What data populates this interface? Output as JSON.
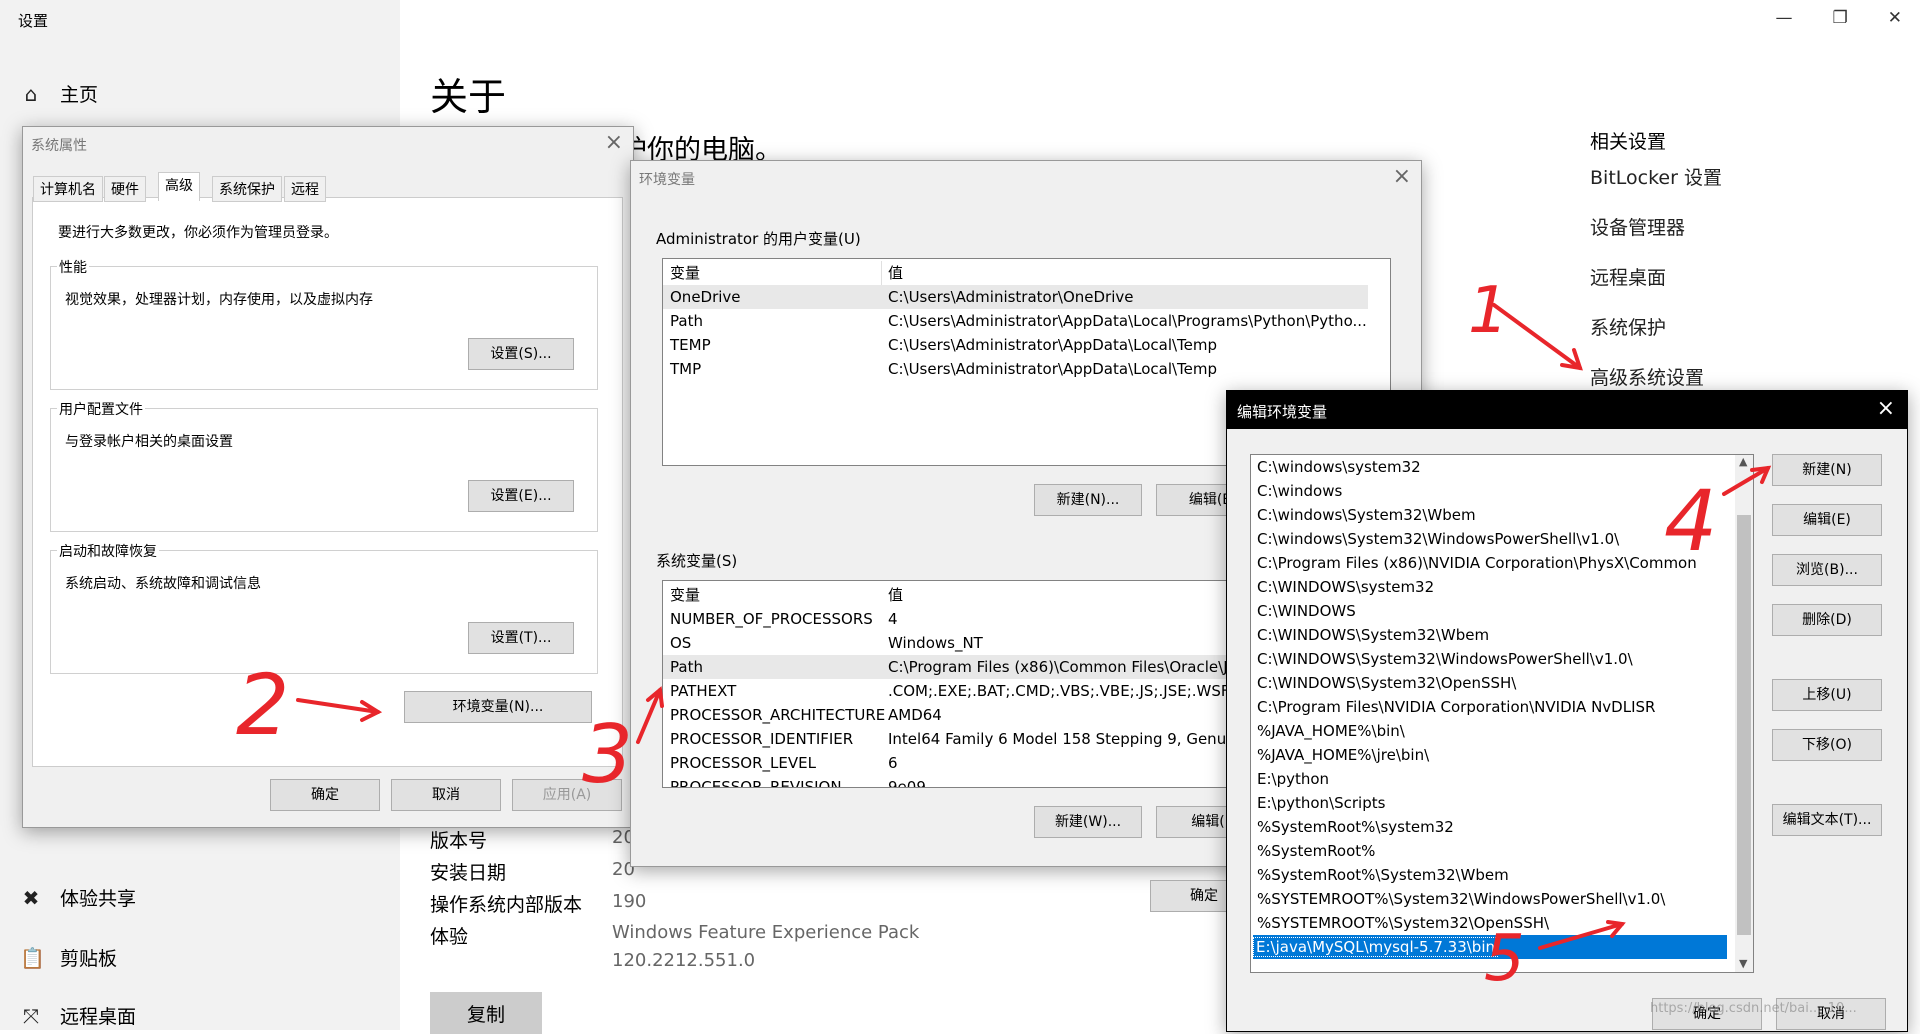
{
  "settings": {
    "title": "设置",
    "nav": {
      "home": "主页",
      "experience": "体验共享",
      "clipboard": "剪贴板",
      "remote": "远程桌面"
    },
    "page_title": "关于",
    "protect_text": "护你的电脑。",
    "related": {
      "title": "相关设置",
      "links": [
        "BitLocker 设置",
        "设备管理器",
        "远程桌面",
        "系统保护",
        "高级系统设置"
      ]
    },
    "specs": [
      {
        "label": "版本号",
        "value": "20"
      },
      {
        "label": "安装日期",
        "value": "20"
      },
      {
        "label": "操作系统内部版本",
        "value": "190"
      },
      {
        "label": "体验",
        "value": "Windows Feature Experience Pack"
      }
    ],
    "experience_version": "120.2212.551.0",
    "copy_label": "复制"
  },
  "sysprops": {
    "title": "系统属性",
    "tabs": [
      "计算机名",
      "硬件",
      "高级",
      "系统保护",
      "远程"
    ],
    "active_tab": "高级",
    "admin_note": "要进行大多数更改，你必须作为管理员登录。",
    "performance": {
      "label": "性能",
      "desc": "视觉效果，处理器计划，内存使用，以及虚拟内存",
      "button": "设置(S)..."
    },
    "profile": {
      "label": "用户配置文件",
      "desc": "与登录帐户相关的桌面设置",
      "button": "设置(E)..."
    },
    "startup": {
      "label": "启动和故障恢复",
      "desc": "系统启动、系统故障和调试信息",
      "button": "设置(T)..."
    },
    "env_button": "环境变量(N)...",
    "ok": "确定",
    "cancel": "取消",
    "apply": "应用(A)"
  },
  "envvars": {
    "title": "环境变量",
    "user_label": "Administrator 的用户变量(U)",
    "col_var": "变量",
    "col_val": "值",
    "user_vars": [
      {
        "k": "OneDrive",
        "v": "C:\\Users\\Administrator\\OneDrive"
      },
      {
        "k": "Path",
        "v": "C:\\Users\\Administrator\\AppData\\Local\\Programs\\Python\\Pytho..."
      },
      {
        "k": "TEMP",
        "v": "C:\\Users\\Administrator\\AppData\\Local\\Temp"
      },
      {
        "k": "TMP",
        "v": "C:\\Users\\Administrator\\AppData\\Local\\Temp"
      }
    ],
    "user_new": "新建(N)...",
    "user_edit": "编辑(E",
    "sys_label": "系统变量(S)",
    "sys_vars": [
      {
        "k": "NUMBER_OF_PROCESSORS",
        "v": "4"
      },
      {
        "k": "OS",
        "v": "Windows_NT"
      },
      {
        "k": "Path",
        "v": "C:\\Program Files (x86)\\Common Files\\Oracle\\Ja"
      },
      {
        "k": "PATHEXT",
        "v": ".COM;.EXE;.BAT;.CMD;.VBS;.VBE;.JS;.JSE;.WSF;.W"
      },
      {
        "k": "PROCESSOR_ARCHITECTURE",
        "v": "AMD64"
      },
      {
        "k": "PROCESSOR_IDENTIFIER",
        "v": "Intel64 Family 6 Model 158 Stepping 9, Genuin"
      },
      {
        "k": "PROCESSOR_LEVEL",
        "v": "6"
      },
      {
        "k": "PROCESSOR_REVISION",
        "v": "9e09"
      }
    ],
    "sys_new": "新建(W)...",
    "sys_edit": "编辑(I",
    "ok": "确定"
  },
  "editenv": {
    "title": "编辑环境变量",
    "paths": [
      "C:\\windows\\system32",
      "C:\\windows",
      "C:\\windows\\System32\\Wbem",
      "C:\\windows\\System32\\WindowsPowerShell\\v1.0\\",
      "C:\\Program Files (x86)\\NVIDIA Corporation\\PhysX\\Common",
      "C:\\WINDOWS\\system32",
      "C:\\WINDOWS",
      "C:\\WINDOWS\\System32\\Wbem",
      "C:\\WINDOWS\\System32\\WindowsPowerShell\\v1.0\\",
      "C:\\WINDOWS\\System32\\OpenSSH\\",
      "C:\\Program Files\\NVIDIA Corporation\\NVIDIA NvDLISR",
      "%JAVA_HOME%\\bin\\",
      "%JAVA_HOME%\\jre\\bin\\",
      "E:\\python",
      "E:\\python\\Scripts",
      "%SystemRoot%\\system32",
      "%SystemRoot%",
      "%SystemRoot%\\System32\\Wbem",
      "%SYSTEMROOT%\\System32\\WindowsPowerShell\\v1.0\\",
      "%SYSTEMROOT%\\System32\\OpenSSH\\",
      "E:\\java\\MySQL\\mysql-5.7.33\\bin"
    ],
    "buttons": {
      "new": "新建(N)",
      "edit": "编辑(E)",
      "browse": "浏览(B)...",
      "delete": "删除(D)",
      "up": "上移(U)",
      "down": "下移(O)",
      "edit_text": "编辑文本(T)..."
    },
    "ok": "确定",
    "cancel": "取消",
    "watermark": "https://blog.csdn.net/bai..._10..."
  },
  "annotations": [
    "1",
    "2",
    "3",
    "4",
    "5"
  ],
  "colors": {
    "annot_red": "#e8262b",
    "selection": "#0078d7"
  }
}
